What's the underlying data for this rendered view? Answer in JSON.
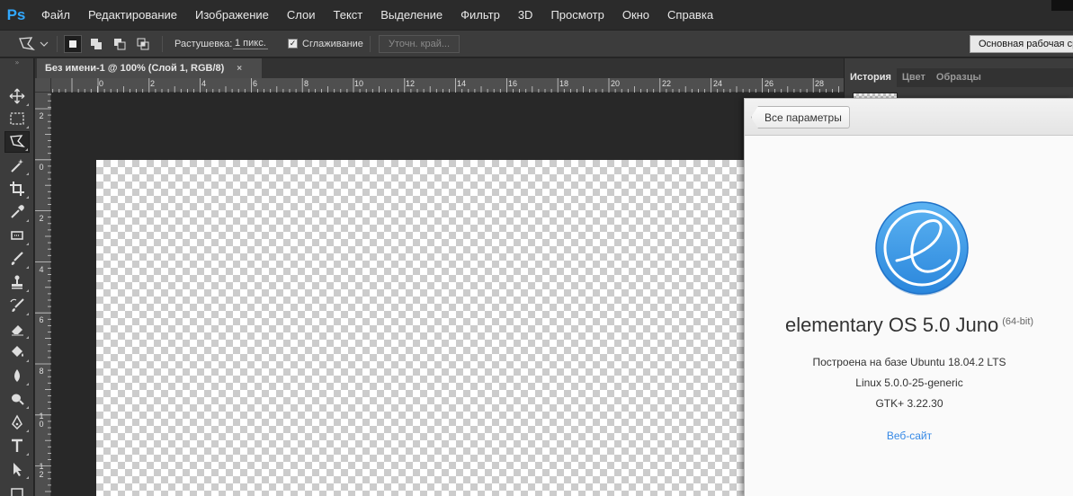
{
  "app": {
    "logo": "Ps"
  },
  "menu": [
    "Файл",
    "Редактирование",
    "Изображение",
    "Слои",
    "Текст",
    "Выделение",
    "Фильтр",
    "3D",
    "Просмотр",
    "Окно",
    "Справка"
  ],
  "options": {
    "tool_icon": "polygonal-lasso-icon",
    "feather_label": "Растушевка:",
    "feather_value": "1 пикс.",
    "antialias_label": "Сглаживание",
    "refine_edge": "Уточн. край...",
    "workspace": "Основная рабочая сред"
  },
  "document": {
    "tab_title": "Без имени-1 @ 100% (Слой 1, RGB/8)",
    "close": "×"
  },
  "rulers": {
    "h_labels": [
      "0",
      "2",
      "4",
      "6",
      "8",
      "10",
      "12",
      "14",
      "16",
      "18",
      "20",
      "22",
      "24",
      "26",
      "28"
    ],
    "v_labels": [
      "2",
      "0",
      "2",
      "4",
      "6",
      "8",
      "1\n0",
      "1\n2"
    ]
  },
  "panels": {
    "tabs": [
      "История",
      "Цвет",
      "Образцы"
    ]
  },
  "about": {
    "back_button": "Все параметры",
    "os_name": "elementary OS 5.0 Juno",
    "arch": "(64-bit)",
    "based_on": "Построена на базе Ubuntu 18.04.2 LTS",
    "kernel": "Linux 5.0.0-25-generic",
    "gtk": "GTK+ 3.22.30",
    "website": "Веб-сайт",
    "logo_color": "#3689e6"
  },
  "tools": [
    "move-icon",
    "marquee-icon",
    "lasso-icon",
    "magic-wand-icon",
    "crop-icon",
    "eyedropper-icon",
    "healing-icon",
    "brush-icon",
    "stamp-icon",
    "history-brush-icon",
    "eraser-icon",
    "bucket-icon",
    "blur-icon",
    "dodge-icon",
    "pen-icon",
    "type-icon",
    "path-select-icon",
    "rectangle-icon"
  ]
}
